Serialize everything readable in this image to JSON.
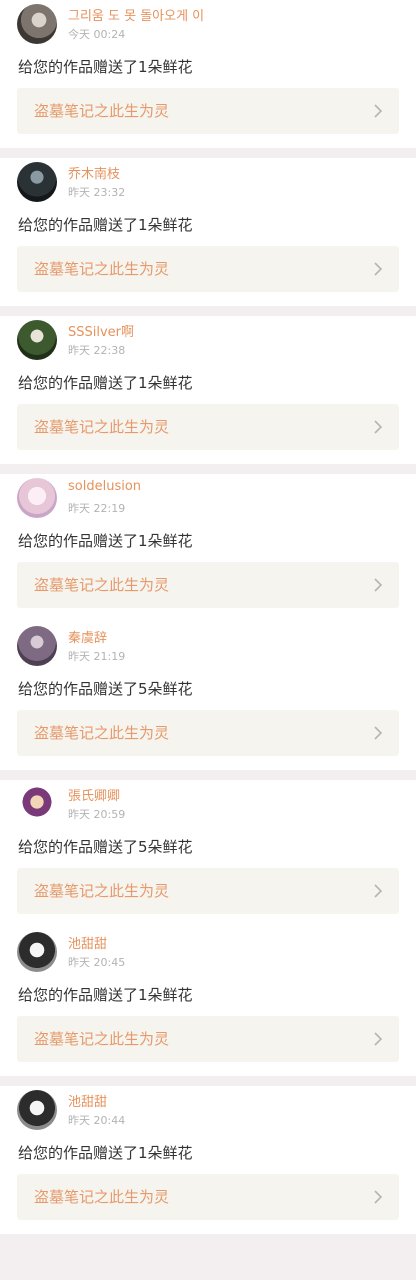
{
  "colors": {
    "username": "#e6925c",
    "time": "#b3b3b3",
    "message": "#333333",
    "work_title": "#e69a6b",
    "work_bg": "#f6f4ee",
    "divider": "#f3eff0"
  },
  "notifications": [
    {
      "username": "그리움 도 못 돌아오게 이",
      "time": "今天 00:24",
      "message": "给您的作品赠送了1朵鲜花",
      "work_title": "盗墓笔记之此生为灵",
      "avatar_icon": "avatar-portrait-gray"
    },
    {
      "username": "乔木南枝",
      "time": "昨天 23:32",
      "message": "给您的作品赠送了1朵鲜花",
      "work_title": "盗墓笔记之此生为灵",
      "avatar_icon": "avatar-portrait-dark"
    },
    {
      "username": "SSSilver啊",
      "time": "昨天 22:38",
      "message": "给您的作品赠送了1朵鲜花",
      "work_title": "盗墓笔记之此生为灵",
      "avatar_icon": "avatar-portrait-green"
    },
    {
      "username": "soldelusion",
      "time": "昨天 22:19",
      "message": "给您的作品赠送了1朵鲜花",
      "work_title": "盗墓笔记之此生为灵",
      "avatar_icon": "avatar-anime-pink"
    },
    {
      "username": "秦虞辞",
      "time": "昨天 21:19",
      "message": "给您的作品赠送了5朵鲜花",
      "work_title": "盗墓笔记之此生为灵",
      "avatar_icon": "avatar-portrait-purple"
    },
    {
      "username": "張氏卿卿",
      "time": "昨天 20:59",
      "message": "给您的作品赠送了5朵鲜花",
      "work_title": "盗墓笔记之此生为灵",
      "avatar_icon": "avatar-pixel-character"
    },
    {
      "username": "池甜甜",
      "time": "昨天 20:45",
      "message": "给您的作品赠送了1朵鲜花",
      "work_title": "盗墓笔记之此生为灵",
      "avatar_icon": "avatar-anime-bw"
    },
    {
      "username": "池甜甜",
      "time": "昨天 20:44",
      "message": "给您的作品赠送了1朵鲜花",
      "work_title": "盗墓笔记之此生为灵",
      "avatar_icon": "avatar-anime-bw"
    }
  ]
}
